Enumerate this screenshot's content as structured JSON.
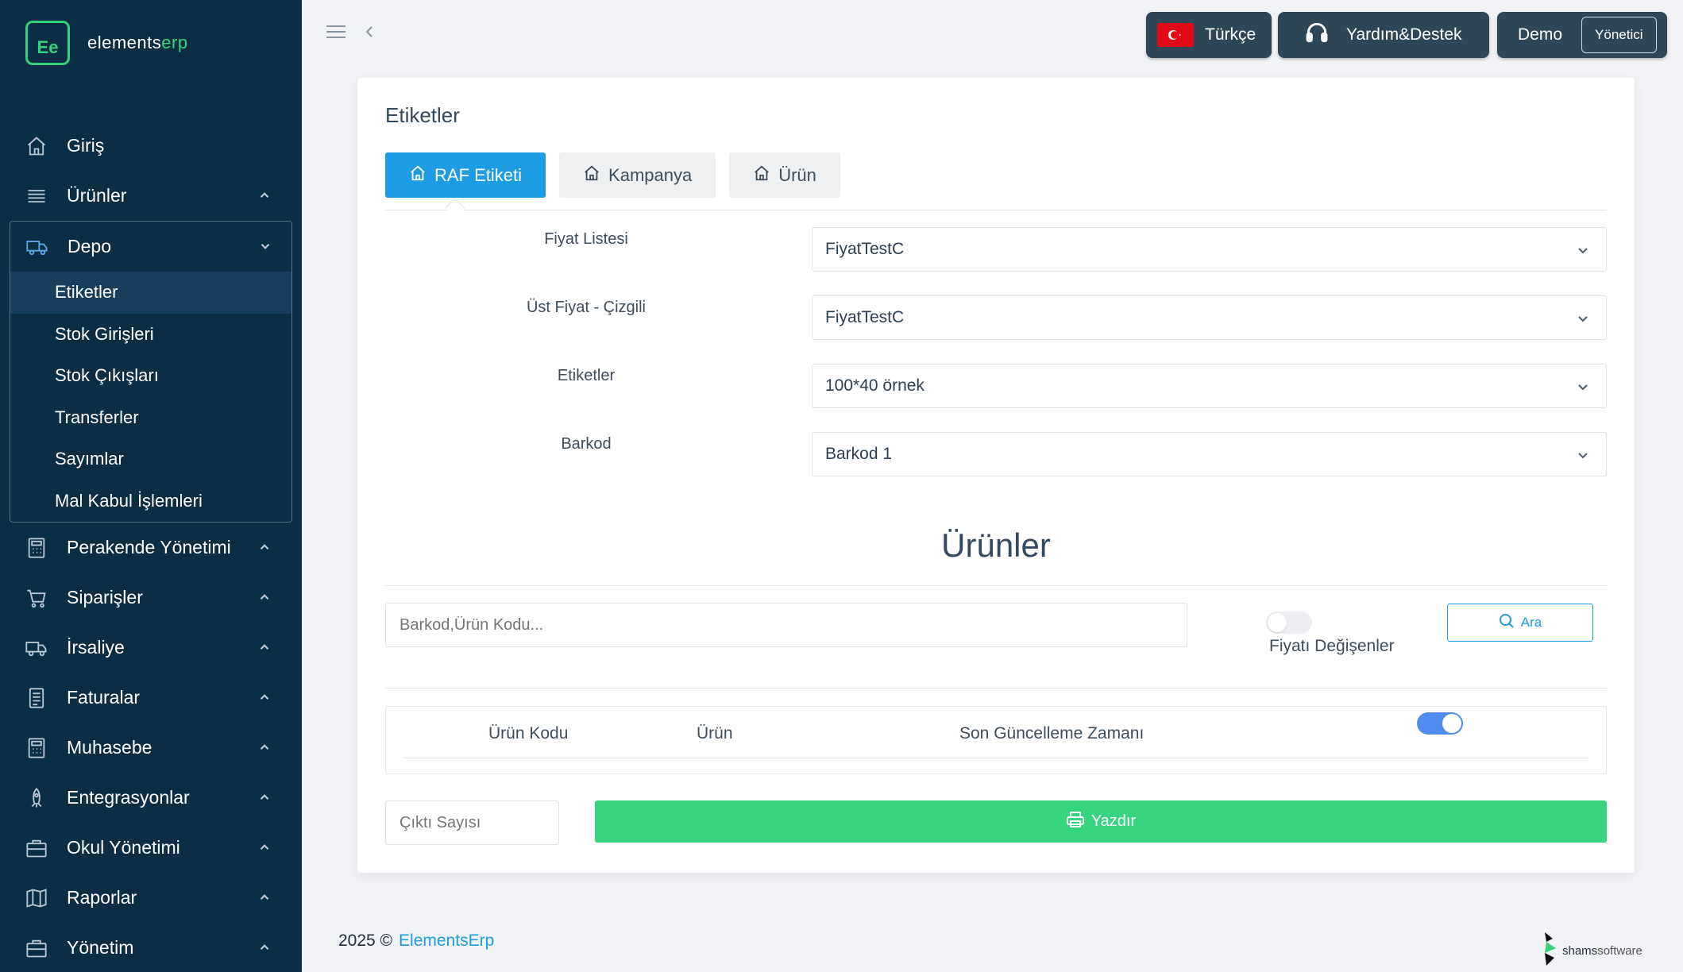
{
  "app": {
    "logo_mark": "Ee",
    "logo_name_a": "elements",
    "logo_name_b": "erp"
  },
  "sidebar": {
    "items_top": [
      {
        "label": "Giriş",
        "icon": "home-icon"
      },
      {
        "label": "Ürünler",
        "icon": "list-icon"
      }
    ],
    "group": {
      "label": "Depo",
      "icon": "truck-icon",
      "sub_items": [
        {
          "label": "Etiketler",
          "active": true
        },
        {
          "label": "Stok Girişleri"
        },
        {
          "label": "Stok Çıkışları"
        },
        {
          "label": "Transferler"
        },
        {
          "label": "Sayımlar"
        },
        {
          "label": "Mal Kabul İşlemleri"
        }
      ]
    },
    "items_bottom": [
      {
        "label": "Perakende Yönetimi",
        "icon": "calculator-icon"
      },
      {
        "label": "Siparişler",
        "icon": "cart-icon"
      },
      {
        "label": "İrsaliye",
        "icon": "truck-icon"
      },
      {
        "label": "Faturalar",
        "icon": "invoice-icon"
      },
      {
        "label": "Muhasebe",
        "icon": "calculator-icon"
      },
      {
        "label": "Entegrasyonlar",
        "icon": "rocket-icon"
      },
      {
        "label": "Okul Yönetimi",
        "icon": "briefcase-icon"
      },
      {
        "label": "Raporlar",
        "icon": "map-icon"
      },
      {
        "label": "Yönetim",
        "icon": "briefcase-icon"
      }
    ]
  },
  "topbar": {
    "language": "Türkçe",
    "help": "Yardım&Destek",
    "user": "Demo",
    "role": "Yönetici"
  },
  "page": {
    "title": "Etiketler",
    "tabs": [
      {
        "label": "RAF Etiketi",
        "active": true
      },
      {
        "label": "Kampanya"
      },
      {
        "label": "Ürün"
      }
    ],
    "form": [
      {
        "label": "Fiyat Listesi",
        "value": "FiyatTestC"
      },
      {
        "label": "Üst Fiyat - Çizgili",
        "value": "FiyatTestC"
      },
      {
        "label": "Etiketler",
        "value": "100*40 örnek"
      },
      {
        "label": "Barkod",
        "value": "Barkod 1"
      }
    ],
    "products_title": "Ürünler",
    "search_placeholder": "Barkod,Ürün Kodu...",
    "price_changed_label": "Fiyatı Değişenler",
    "search_button": "Ara",
    "table_headers": [
      "Ürün Kodu",
      "Ürün",
      "Son Güncelleme Zamanı"
    ],
    "output_count_placeholder": "Çıktı Sayısı",
    "print_button": "Yazdır"
  },
  "footer": {
    "year": "2025 ©",
    "brand": "ElementsErp",
    "vendor_a": "shams",
    "vendor_b": "software"
  },
  "colors": {
    "sidebar_bg": "#0b2e45",
    "accent_blue": "#1d9ce3",
    "accent_green": "#36d47f",
    "toggle_on": "#4e8cf0",
    "topbar_btn": "#2f4656"
  }
}
